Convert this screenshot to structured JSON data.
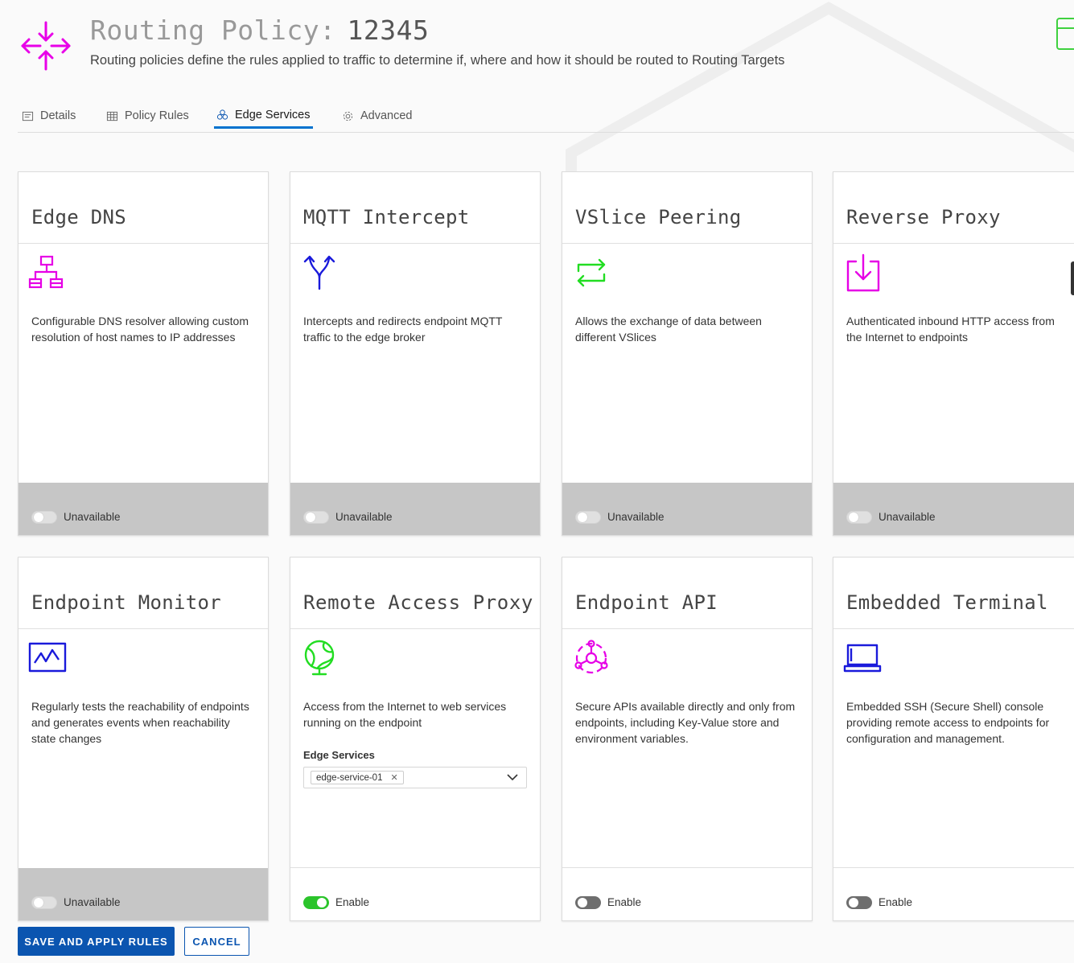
{
  "header": {
    "title_label": "Routing Policy:",
    "policy_id": "12345",
    "subtitle": "Routing policies define the rules applied to traffic to determine if, where and how it should be routed to Routing Targets",
    "icon": "routing-arrows-icon",
    "accent_color": "#e800e8"
  },
  "tabs": [
    {
      "label": "Details",
      "icon": "details-icon"
    },
    {
      "label": "Policy Rules",
      "icon": "rules-icon"
    },
    {
      "label": "Edge Services",
      "icon": "edge-services-icon",
      "active": true
    },
    {
      "label": "Advanced",
      "icon": "gear-icon"
    }
  ],
  "cards": [
    {
      "title": "Edge DNS",
      "icon": "network-tree-icon",
      "icon_color": "#e600e6",
      "description": "Configurable DNS resolver allowing custom resolution of host names to IP addresses",
      "toggle_label": "Unavailable",
      "state": "unavailable"
    },
    {
      "title": "MQTT Intercept",
      "icon": "split-arrows-icon",
      "icon_color": "#1a1adb",
      "description": "Intercepts and redirects endpoint MQTT traffic to the edge broker",
      "toggle_label": "Unavailable",
      "state": "unavailable"
    },
    {
      "title": "VSlice Peering",
      "icon": "exchange-arrows-icon",
      "icon_color": "#22dd22",
      "description": "Allows the exchange of data between different VSlices",
      "toggle_label": "Unavailable",
      "state": "unavailable"
    },
    {
      "title": "Reverse Proxy",
      "icon": "download-tray-icon",
      "icon_color": "#e600e6",
      "description": "Authenticated inbound HTTP access from the Internet to endpoints",
      "toggle_label": "Unavailable",
      "state": "unavailable"
    },
    {
      "title": "Endpoint Monitor",
      "icon": "monitor-pulse-icon",
      "icon_color": "#1a1adb",
      "description": "Regularly tests the reachability of endpoints and generates events when reachability state changes",
      "toggle_label": "Unavailable",
      "state": "unavailable"
    },
    {
      "title": "Remote Access Proxy",
      "icon": "globe-icon",
      "icon_color": "#22dd22",
      "description": "Access from the Internet to web services running on the endpoint",
      "toggle_label": "Enable",
      "state": "on",
      "field_label": "Edge Services",
      "selected_chip": "edge-service-01"
    },
    {
      "title": "Endpoint API",
      "icon": "api-hub-icon",
      "icon_color": "#e600e6",
      "description": "Secure APIs available directly and only from endpoints, including Key-Value store and environment variables.",
      "toggle_label": "Enable",
      "state": "off"
    },
    {
      "title": "Embedded Terminal",
      "icon": "laptop-icon",
      "icon_color": "#1a1adb",
      "description": "Embedded SSH (Secure Shell) console providing remote access to endpoints for configuration and management.",
      "toggle_label": "Enable",
      "state": "off"
    }
  ],
  "actions": {
    "save_label": "SAVE AND APPLY RULES",
    "cancel_label": "CANCEL"
  }
}
